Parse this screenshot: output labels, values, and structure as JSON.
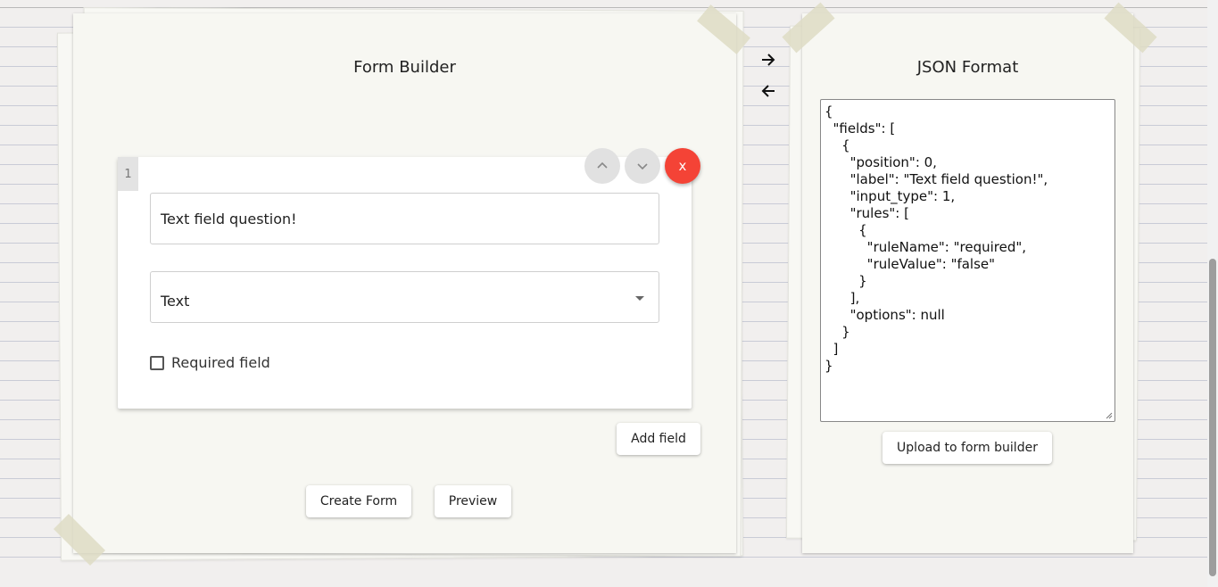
{
  "builder": {
    "title": "Form Builder",
    "field": {
      "index": "1",
      "label_value": "Text field question!",
      "type_value": "Text",
      "required_label": "Required field",
      "required_checked": false,
      "delete_label": "X"
    },
    "add_field_label": "Add field",
    "create_form_label": "Create Form",
    "preview_label": "Preview"
  },
  "json_panel": {
    "title": "JSON Format",
    "content": "{\n  \"fields\": [\n    {\n      \"position\": 0,\n      \"label\": \"Text field question!\",\n      \"input_type\": 1,\n      \"rules\": [\n        {\n          \"ruleName\": \"required\",\n          \"ruleValue\": \"false\"\n        }\n      ],\n      \"options\": null\n    }\n  ]\n}",
    "upload_label": "Upload to form builder"
  },
  "icons": {
    "move_up": "chevron-up-icon",
    "move_down": "chevron-down-icon",
    "to_json": "arrow-right-icon",
    "to_builder": "arrow-left-icon"
  },
  "colors": {
    "delete_button": "#f44336",
    "paper": "#f7f7f2",
    "background": "#f1efee"
  }
}
